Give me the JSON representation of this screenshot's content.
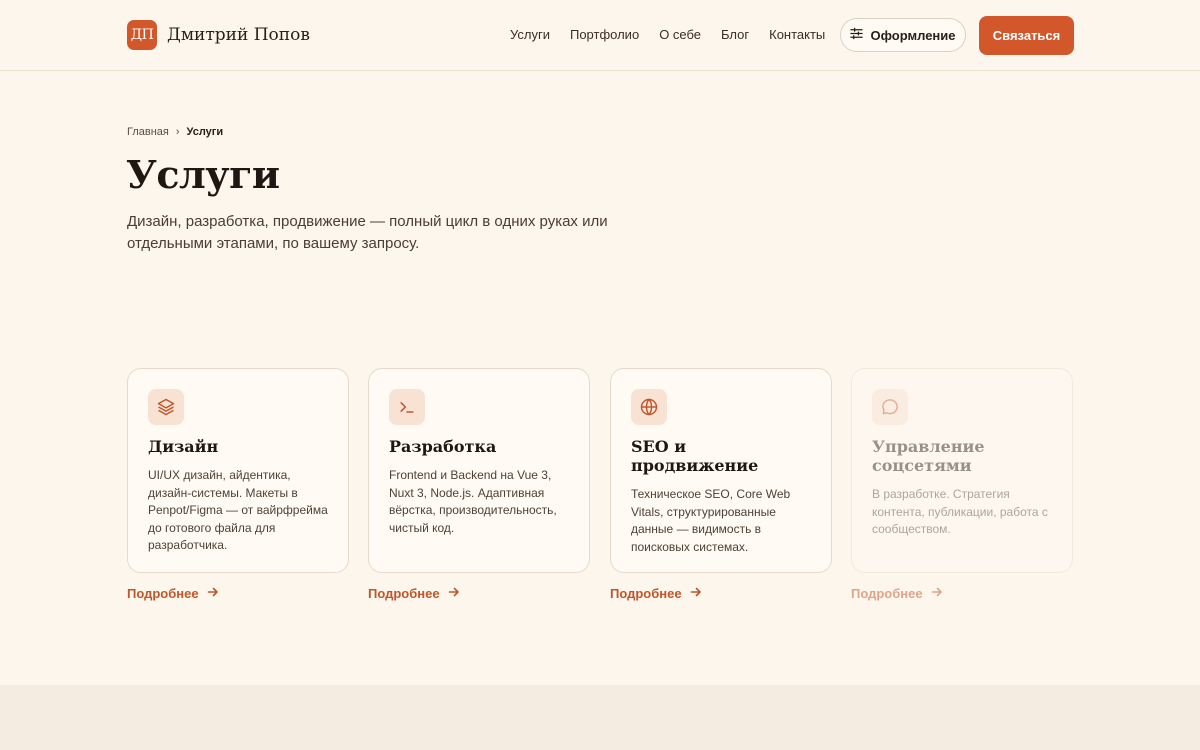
{
  "brand": {
    "monogram": "ДП",
    "name": "Дмитрий Попов"
  },
  "nav": [
    "Услуги",
    "Портфолио",
    "О себе",
    "Блог",
    "Контакты"
  ],
  "header": {
    "theme_label": "Оформление",
    "contact_label": "Связаться"
  },
  "breadcrumb": {
    "home": "Главная",
    "separator": "›",
    "current": "Услуги"
  },
  "page": {
    "title": "Услуги",
    "lead": "Дизайн, разработка, продвижение — полный цикл в одних руках или отдельными этапами, по вашему запросу."
  },
  "services": [
    {
      "title": "Дизайн",
      "text": "UI/UX дизайн, айдентика, дизайн-системы. Макеты в Penpot/Figma — от вайрфрейма до готового файла для разработчика.",
      "more": "Подробнее",
      "icon": "layers-icon"
    },
    {
      "title": "Разработка",
      "text": "Frontend и Backend на Vue 3, Nuxt 3, Node.js. Адаптивная вёрстка, производительность, чистый код.",
      "more": "Подробнее",
      "icon": "terminal-icon"
    },
    {
      "title": "SEO и продвижение",
      "text": "Техническое SEO, Core Web Vitals, структурированные данные — видимость в поисковых системах.",
      "more": "Подробнее",
      "icon": "globe-icon"
    },
    {
      "title": "Управление соцсетями",
      "text": "В разработке. Стратегия контента, публикации, работа с сообществом.",
      "more": "Подробнее",
      "icon": "chat-bubble-icon"
    }
  ],
  "colors": {
    "accent": "#d2572a",
    "background": "#fdf6ec",
    "card": "#fffaf3"
  }
}
